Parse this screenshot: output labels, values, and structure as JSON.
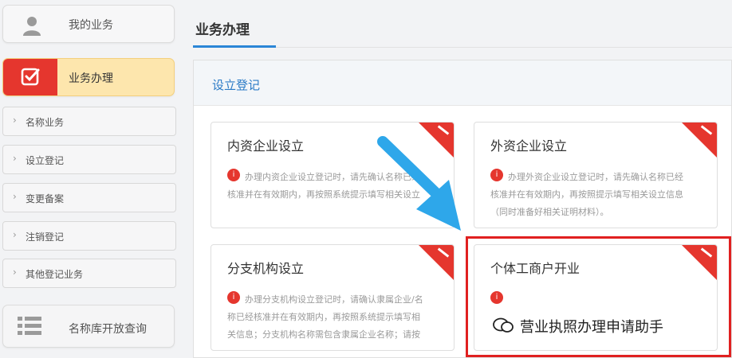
{
  "sidebar": {
    "my_business": "我的业务",
    "business_handling": "业务办理",
    "items": [
      {
        "label": "名称业务"
      },
      {
        "label": "设立登记"
      },
      {
        "label": "变更备案"
      },
      {
        "label": "注销登记"
      },
      {
        "label": "其他登记业务"
      }
    ],
    "name_query": "名称库开放查询"
  },
  "main": {
    "title": "业务办理",
    "section": "设立登记",
    "cards": [
      {
        "title": "内资企业设立",
        "icon": "info-icon",
        "desc": "办理内资企业设立登记时，请先确认名称已经核准并在有效期内，再按照系统提示填写相关设立信息并提交申请材料办理登记。"
      },
      {
        "title": "外资企业设立",
        "icon": "info-icon",
        "desc": "办理外资企业设立登记时，请先确认名称已经核准并在有效期内，再按照提示填写相关设立信息（同时准备好相关证明材料）。"
      },
      {
        "title": "分支机构设立",
        "icon": "info-icon",
        "desc": "办理分支机构设立登记时，请确认隶属企业/名称已经核准并在有效期内，再按照系统提示填写相关信息；分支机构名称需包含隶属企业名称；请按照系统提示填写相关设立信息并提交申请材料办理登记。"
      },
      {
        "title": "个体工商户开业",
        "icon": "info-icon",
        "desc": ""
      }
    ]
  },
  "watermark": {
    "text": "营业执照办理申请助手"
  },
  "colors": {
    "accent_red": "#e5362e",
    "link_blue": "#2b7bc6",
    "highlight_yellow": "#fde6ad",
    "arrow_blue": "#2ea7ea"
  }
}
